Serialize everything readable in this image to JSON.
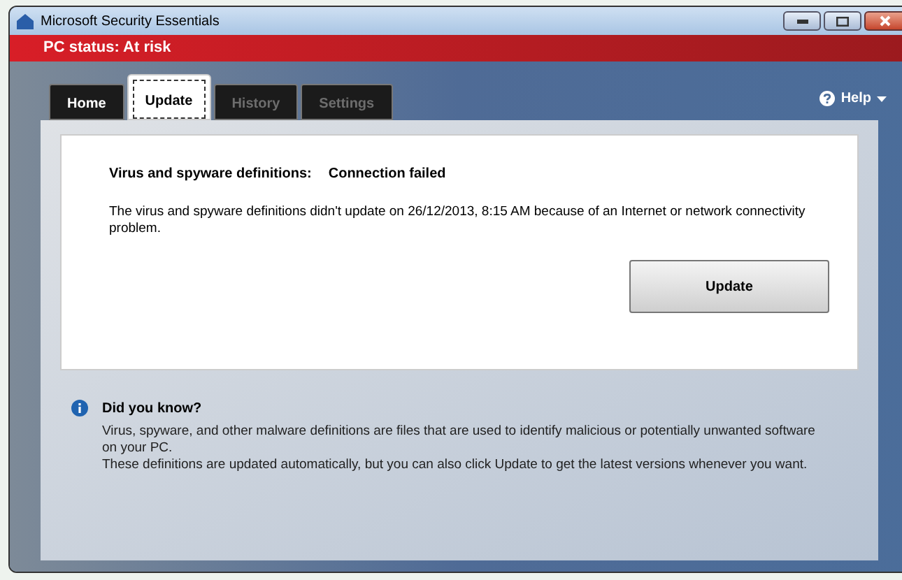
{
  "window": {
    "title": "Microsoft Security Essentials"
  },
  "status_bar": {
    "text": "PC status: At risk"
  },
  "tabs": [
    {
      "label": "Home",
      "selected": false,
      "disabled": false
    },
    {
      "label": "Update",
      "selected": true,
      "disabled": false
    },
    {
      "label": "History",
      "selected": false,
      "disabled": true
    },
    {
      "label": "Settings",
      "selected": false,
      "disabled": true
    }
  ],
  "help": {
    "label": "Help"
  },
  "definitions": {
    "label": "Virus and spyware definitions:",
    "value": "Connection failed",
    "message": "The virus and spyware definitions didn't update on 26/12/2013, 8:15 AM because of an Internet or network connectivity problem.",
    "button": "Update"
  },
  "did_you_know": {
    "title": "Did you know?",
    "paragraphs": [
      "Virus, spyware, and other malware definitions are files that are used to identify malicious or potentially unwanted software on your PC.",
      "These definitions are updated automatically, but you can also click Update to get the latest versions whenever you want."
    ]
  }
}
